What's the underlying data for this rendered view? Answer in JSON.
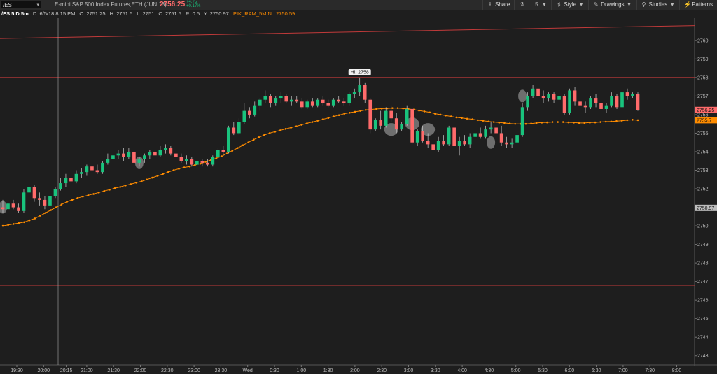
{
  "topbar": {
    "symbol": "/ES",
    "description": "E-mini S&P 500 Index Futures,ETH (JUN 18)",
    "last_price": "2756.25",
    "change": "+4.75",
    "change_pct": "+0.17%",
    "buttons": [
      {
        "label": "Share",
        "icon": "share-icon"
      },
      {
        "label": "",
        "icon": "flask-icon"
      },
      {
        "label": "",
        "icon": "timeframe-icon"
      },
      {
        "label": "Style",
        "icon": "style-icon"
      },
      {
        "label": "Drawings",
        "icon": "drawings-icon"
      },
      {
        "label": "Studies",
        "icon": "studies-icon"
      },
      {
        "label": "Patterns",
        "icon": "patterns-icon"
      }
    ]
  },
  "infobar": {
    "period": "/ES 5 D 5m",
    "date": "D: 6/5/18 8:15 PM",
    "open": "O: 2751.25",
    "high": "H: 2751.5",
    "low": "L: 2751",
    "close": "C: 2751.5",
    "range": "R: 0.5",
    "y": "Y: 2750.97",
    "study_name": "PIK_RAM_5MIN",
    "study_value": "2750.59"
  },
  "studies_row": {
    "labels": [
      "AD: N/A",
      "ADPF: N/A"
    ]
  },
  "colors": {
    "up": "#19c37d",
    "down": "#ff6b6b",
    "ma": "#ff8c00",
    "hline": "#c13a3a"
  },
  "chart_data": {
    "type": "candlestick",
    "ylim": [
      2742.5,
      2761.2
    ],
    "y_ticks": [
      2743,
      2744,
      2745,
      2746,
      2747,
      2748,
      2749,
      2750,
      2751,
      2752,
      2753,
      2754,
      2755,
      2756,
      2757,
      2758,
      2759,
      2760
    ],
    "x_ticks": [
      "19:30",
      "20:00",
      "20:15",
      "21:00",
      "21:30",
      "22:00",
      "22:30",
      "23:00",
      "23:30",
      "Wed",
      "0:30",
      "1:00",
      "1:30",
      "2:00",
      "2:30",
      "3:00",
      "3:30",
      "4:00",
      "4:30",
      "5:00",
      "5:30",
      "6:00",
      "6:30",
      "7:00",
      "7:30",
      "8:00"
    ],
    "hi_label": "Hi: 2758",
    "price_labels": {
      "last": "2756.25",
      "ma": "2755.7",
      "cursor": "2750.97"
    },
    "horizontal_lines": [
      2758,
      2746.8
    ],
    "cursor_y": 2750.97,
    "trend_start": 2760.1,
    "trend_end": 2760.8,
    "candles": [
      [
        2751,
        2751.4,
        2750.7,
        2750.9
      ],
      [
        2750.9,
        2751.3,
        2750.6,
        2751.2
      ],
      [
        2751.2,
        2751.4,
        2750.9,
        2751
      ],
      [
        2751,
        2751.2,
        2750.7,
        2750.8
      ],
      [
        2750.8,
        2752,
        2750.7,
        2751.8
      ],
      [
        2751.8,
        2752.4,
        2751.6,
        2752.1
      ],
      [
        2752.1,
        2752.2,
        2751.3,
        2751.5
      ],
      [
        2751.5,
        2751.8,
        2751.1,
        2751.4
      ],
      [
        2751.4,
        2751.6,
        2750.9,
        2751.1
      ],
      [
        2751.1,
        2751.7,
        2751,
        2751.6
      ],
      [
        2751.6,
        2752.1,
        2751.5,
        2752
      ],
      [
        2752,
        2752.6,
        2751.9,
        2752.3
      ],
      [
        2752.3,
        2752.8,
        2752.1,
        2752.6
      ],
      [
        2752.6,
        2752.9,
        2752.2,
        2752.4
      ],
      [
        2752.4,
        2753,
        2752.3,
        2752.8
      ],
      [
        2752.8,
        2753.1,
        2752.6,
        2752.9
      ],
      [
        2752.9,
        2753.3,
        2752.7,
        2753.2
      ],
      [
        2753.2,
        2753.4,
        2752.9,
        2753
      ],
      [
        2753,
        2753.3,
        2752.8,
        2752.9
      ],
      [
        2752.9,
        2753.5,
        2752.8,
        2753.4
      ],
      [
        2753.4,
        2753.9,
        2753.3,
        2753.6
      ],
      [
        2753.6,
        2754,
        2753.4,
        2753.8
      ],
      [
        2753.8,
        2754.1,
        2753.6,
        2753.9
      ],
      [
        2753.9,
        2754.2,
        2753.5,
        2753.7
      ],
      [
        2753.7,
        2754.2,
        2753.6,
        2754
      ],
      [
        2754,
        2754.1,
        2753.3,
        2753.4
      ],
      [
        2753.4,
        2753.7,
        2753.2,
        2753.6
      ],
      [
        2753.6,
        2753.9,
        2753.4,
        2753.8
      ],
      [
        2753.8,
        2754.1,
        2753.6,
        2754
      ],
      [
        2754,
        2754.2,
        2753.7,
        2753.8
      ],
      [
        2753.8,
        2754.3,
        2753.7,
        2754.1
      ],
      [
        2754.1,
        2754.4,
        2753.9,
        2754.2
      ],
      [
        2754.2,
        2754.3,
        2753.8,
        2753.9
      ],
      [
        2753.9,
        2754.1,
        2753.5,
        2753.7
      ],
      [
        2753.7,
        2753.9,
        2753.4,
        2753.5
      ],
      [
        2753.5,
        2753.8,
        2753.3,
        2753.6
      ],
      [
        2753.6,
        2753.7,
        2753.2,
        2753.3
      ],
      [
        2753.3,
        2753.6,
        2753.2,
        2753.5
      ],
      [
        2753.5,
        2753.6,
        2753.2,
        2753.4
      ],
      [
        2753.4,
        2753.6,
        2753.2,
        2753.3
      ],
      [
        2753.3,
        2753.8,
        2753.2,
        2753.7
      ],
      [
        2753.7,
        2754.2,
        2753.6,
        2754.1
      ],
      [
        2754.1,
        2754.3,
        2753.8,
        2754
      ],
      [
        2754,
        2755.4,
        2753.9,
        2755.3
      ],
      [
        2755.3,
        2755.6,
        2754.9,
        2755
      ],
      [
        2755,
        2755.8,
        2754.9,
        2755.6
      ],
      [
        2755.6,
        2756.6,
        2755.5,
        2756.2
      ],
      [
        2756.2,
        2756.4,
        2755.8,
        2756
      ],
      [
        2756,
        2756.7,
        2755.9,
        2756.5
      ],
      [
        2756.5,
        2756.9,
        2756.2,
        2756.8
      ],
      [
        2756.8,
        2757.3,
        2756.6,
        2757
      ],
      [
        2757,
        2757.1,
        2756.4,
        2756.6
      ],
      [
        2756.6,
        2757,
        2756.5,
        2756.9
      ],
      [
        2756.9,
        2757.2,
        2756.6,
        2757
      ],
      [
        2757,
        2757.1,
        2756.6,
        2756.7
      ],
      [
        2756.7,
        2757,
        2756.5,
        2756.8
      ],
      [
        2756.8,
        2757,
        2756.6,
        2756.7
      ],
      [
        2756.7,
        2756.9,
        2756.3,
        2756.4
      ],
      [
        2756.4,
        2756.8,
        2756.3,
        2756.7
      ],
      [
        2756.7,
        2756.9,
        2756.4,
        2756.5
      ],
      [
        2756.5,
        2756.9,
        2756.4,
        2756.8
      ],
      [
        2756.8,
        2757,
        2756.5,
        2756.6
      ],
      [
        2756.6,
        2756.8,
        2756.4,
        2756.5
      ],
      [
        2756.5,
        2756.9,
        2756.4,
        2756.8
      ],
      [
        2756.8,
        2757,
        2756.6,
        2756.7
      ],
      [
        2756.7,
        2756.9,
        2756.5,
        2756.6
      ],
      [
        2756.6,
        2757.2,
        2756.5,
        2757.1
      ],
      [
        2757.1,
        2757.4,
        2756.9,
        2757.2
      ],
      [
        2757.2,
        2758,
        2757,
        2757.6
      ],
      [
        2757.6,
        2757.7,
        2756.6,
        2756.8
      ],
      [
        2756.8,
        2756.9,
        2755,
        2755.2
      ],
      [
        2755.2,
        2755.8,
        2755.1,
        2755.7
      ],
      [
        2755.7,
        2756.2,
        2755.2,
        2755.4
      ],
      [
        2755.4,
        2756.4,
        2755.3,
        2756.2
      ],
      [
        2756.2,
        2756.5,
        2755.6,
        2755.8
      ],
      [
        2755.8,
        2756.1,
        2755,
        2755.2
      ],
      [
        2755.2,
        2755.6,
        2755.1,
        2755.5
      ],
      [
        2755.5,
        2756.5,
        2755.4,
        2756.3
      ],
      [
        2756.3,
        2756.4,
        2754.4,
        2754.5
      ],
      [
        2754.5,
        2755.2,
        2754.3,
        2755.1
      ],
      [
        2755.1,
        2755.4,
        2754.5,
        2754.6
      ],
      [
        2754.6,
        2755,
        2754.2,
        2754.4
      ],
      [
        2754.4,
        2754.8,
        2754,
        2754.1
      ],
      [
        2754.1,
        2754.8,
        2754,
        2754.6
      ],
      [
        2754.6,
        2754.9,
        2754.3,
        2754.4
      ],
      [
        2754.4,
        2755.4,
        2754.3,
        2755.3
      ],
      [
        2755.3,
        2755.6,
        2754.2,
        2754.3
      ],
      [
        2754.3,
        2754.8,
        2753.8,
        2754.6
      ],
      [
        2754.6,
        2754.9,
        2754.3,
        2754.4
      ],
      [
        2754.4,
        2755,
        2754.2,
        2754.8
      ],
      [
        2754.8,
        2755.2,
        2754.6,
        2755
      ],
      [
        2755,
        2755.3,
        2754.7,
        2754.8
      ],
      [
        2754.8,
        2755.4,
        2754.7,
        2755.2
      ],
      [
        2755.2,
        2755.6,
        2755,
        2755.3
      ],
      [
        2755.3,
        2755.5,
        2754.9,
        2755
      ],
      [
        2755,
        2755.4,
        2754.3,
        2754.5
      ],
      [
        2754.5,
        2754.8,
        2754.2,
        2754.4
      ],
      [
        2754.4,
        2754.7,
        2754.2,
        2754.5
      ],
      [
        2754.5,
        2755,
        2754.4,
        2754.9
      ],
      [
        2754.9,
        2756.6,
        2754.8,
        2756.4
      ],
      [
        2756.4,
        2757.2,
        2756.2,
        2757
      ],
      [
        2757,
        2757.6,
        2756.9,
        2757.4
      ],
      [
        2757.4,
        2757.8,
        2756.8,
        2757
      ],
      [
        2757,
        2757.3,
        2756.6,
        2756.9
      ],
      [
        2756.9,
        2757.2,
        2756.7,
        2757.1
      ],
      [
        2757.1,
        2757.2,
        2756.6,
        2756.8
      ],
      [
        2756.8,
        2757.2,
        2756.7,
        2757
      ],
      [
        2757,
        2757.1,
        2756,
        2756.1
      ],
      [
        2756.1,
        2757.4,
        2756,
        2757.3
      ],
      [
        2757.3,
        2757.5,
        2756.5,
        2756.7
      ],
      [
        2756.7,
        2756.9,
        2756.3,
        2756.5
      ],
      [
        2756.5,
        2756.7,
        2756.1,
        2756.4
      ],
      [
        2756.4,
        2757,
        2756.3,
        2756.9
      ],
      [
        2756.9,
        2757.1,
        2756.4,
        2756.6
      ],
      [
        2756.6,
        2756.8,
        2756.2,
        2756.3
      ],
      [
        2756.3,
        2756.6,
        2756.1,
        2756.5
      ],
      [
        2756.5,
        2757.2,
        2756.4,
        2757
      ],
      [
        2757,
        2757.1,
        2756.3,
        2756.4
      ],
      [
        2756.4,
        2757.6,
        2756.3,
        2757.2
      ],
      [
        2757.2,
        2757.4,
        2756.8,
        2757
      ],
      [
        2757,
        2757.2,
        2756.9,
        2757.1
      ],
      [
        2757.1,
        2757.2,
        2756.2,
        2756.25
      ]
    ],
    "moving_average": [
      2750,
      2750.05,
      2750.1,
      2750.15,
      2750.2,
      2750.3,
      2750.4,
      2750.55,
      2750.7,
      2750.85,
      2751,
      2751.15,
      2751.3,
      2751.4,
      2751.5,
      2751.58,
      2751.65,
      2751.72,
      2751.8,
      2751.88,
      2751.95,
      2752.03,
      2752.1,
      2752.18,
      2752.25,
      2752.33,
      2752.4,
      2752.5,
      2752.6,
      2752.7,
      2752.8,
      2752.9,
      2753,
      2753.08,
      2753.15,
      2753.2,
      2753.28,
      2753.35,
      2753.45,
      2753.55,
      2753.65,
      2753.75,
      2753.9,
      2754.05,
      2754.2,
      2754.35,
      2754.5,
      2754.65,
      2754.78,
      2754.9,
      2755,
      2755.08,
      2755.15,
      2755.23,
      2755.3,
      2755.37,
      2755.45,
      2755.53,
      2755.6,
      2755.67,
      2755.75,
      2755.82,
      2755.9,
      2755.97,
      2756.05,
      2756.1,
      2756.15,
      2756.2,
      2756.25,
      2756.28,
      2756.3,
      2756.32,
      2756.33,
      2756.35,
      2756.35,
      2756.33,
      2756.3,
      2756.27,
      2756.22,
      2756.17,
      2756.12,
      2756.05,
      2756,
      2755.95,
      2755.9,
      2755.85,
      2755.82,
      2755.78,
      2755.75,
      2755.7,
      2755.67,
      2755.63,
      2755.6,
      2755.57,
      2755.55,
      2755.52,
      2755.5,
      2755.5,
      2755.5,
      2755.52,
      2755.55,
      2755.57,
      2755.58,
      2755.6,
      2755.6,
      2755.6,
      2755.58,
      2755.57,
      2755.55,
      2755.55,
      2755.57,
      2755.58,
      2755.6,
      2755.62,
      2755.63,
      2755.65,
      2755.67,
      2755.7,
      2755.72,
      2755.7
    ]
  }
}
